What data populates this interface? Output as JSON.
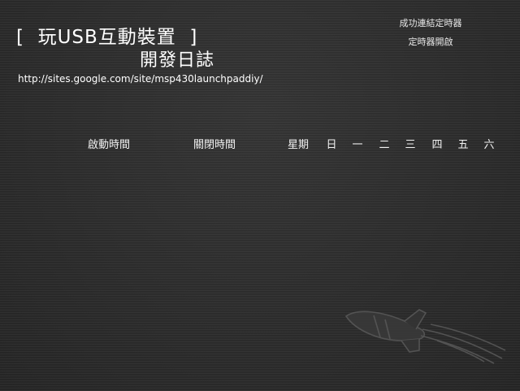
{
  "header": {
    "title": "[  玩USB互動裝置  ]",
    "subtitle": "開發日誌",
    "url": "http://sites.google.com/site/msp430launchpaddiy/"
  },
  "status": {
    "connection": "成功連結定時器",
    "timer": "定時器開啟"
  },
  "schedule": {
    "start_label": "啟動時間",
    "stop_label": "關閉時間",
    "week_label": "星期",
    "weekdays": [
      "日",
      "一",
      "二",
      "三",
      "四",
      "五",
      "六"
    ]
  },
  "watermark_icon": "rocket-icon"
}
